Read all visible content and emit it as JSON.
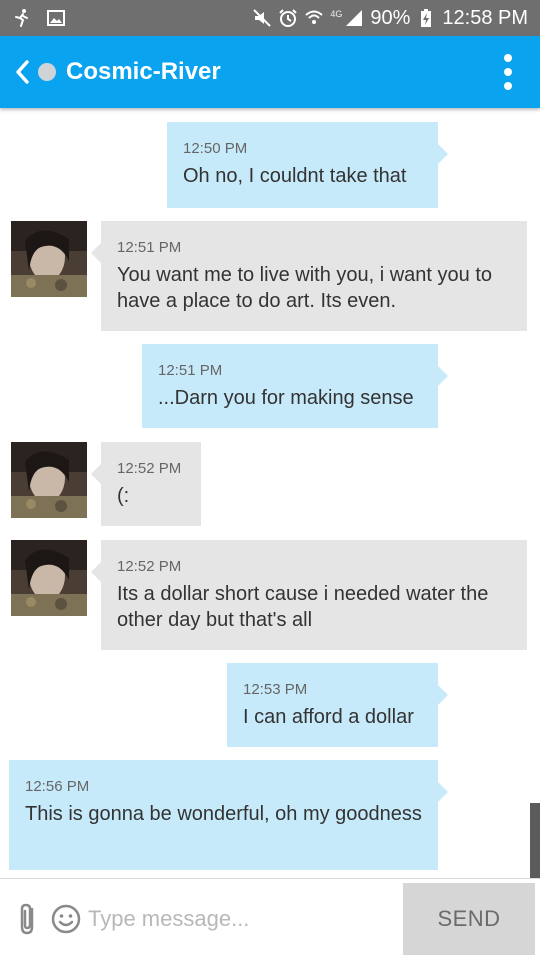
{
  "status_bar": {
    "battery": "90%",
    "time": "12:58 PM",
    "network": "4G",
    "icons": [
      "running-person-icon",
      "image-icon",
      "mute-icon",
      "alarm-icon",
      "wifi-icon",
      "signal-icon",
      "battery-charging-icon"
    ]
  },
  "header": {
    "contact_name": "Cosmic-River",
    "presence": "offline",
    "back_icon": "chevron-left-icon",
    "menu_icon": "more-vertical-icon"
  },
  "messages": [
    {
      "direction": "out",
      "time": "12:50 PM",
      "text": "Oh no, I couldnt take that"
    },
    {
      "direction": "in",
      "time": "12:51 PM",
      "text": "You want me to live with you, i want you to have a place to do art. Its even."
    },
    {
      "direction": "out",
      "time": "12:51 PM",
      "text": "...Darn you for making sense"
    },
    {
      "direction": "in",
      "time": "12:52 PM",
      "text": "(:"
    },
    {
      "direction": "in",
      "time": "12:52 PM",
      "text": "Its a dollar short cause i needed water the other day but that's all"
    },
    {
      "direction": "out",
      "time": "12:53 PM",
      "text": "I can afford a dollar"
    },
    {
      "direction": "out",
      "time": "12:56 PM",
      "text": "This is gonna be wonderful, oh my goodness"
    }
  ],
  "composer": {
    "placeholder": "Type message...",
    "send_label": "SEND",
    "attach_icon": "paperclip-icon",
    "emoji_icon": "smiley-icon"
  },
  "colors": {
    "app_bar": "#0aa3f0",
    "status_bar": "#6f6f6f",
    "outgoing_bubble": "#c7eafb",
    "incoming_bubble": "#e5e5e5",
    "send_button": "#d6d6d6"
  }
}
